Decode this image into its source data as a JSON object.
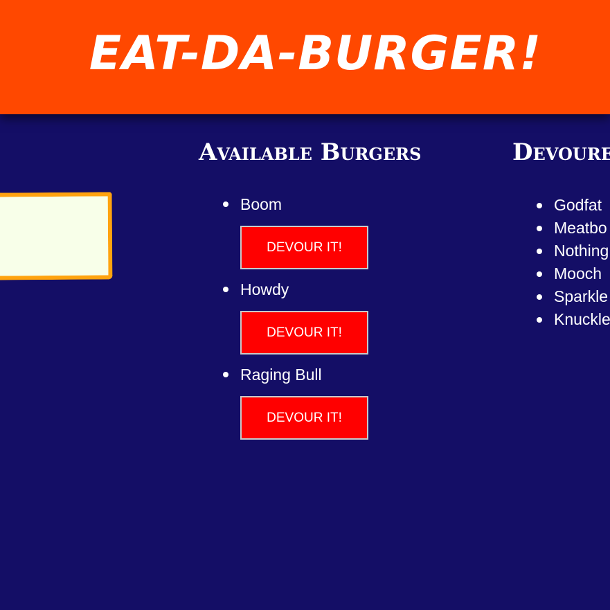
{
  "header": {
    "title": "EAT-DA-BURGER!"
  },
  "add_form": {
    "input_value": ""
  },
  "available": {
    "heading": "Available Burgers",
    "items": [
      {
        "name": "Boom",
        "button_label": "DEVOUR IT!"
      },
      {
        "name": "Howdy",
        "button_label": "DEVOUR IT!"
      },
      {
        "name": "Raging Bull",
        "button_label": "DEVOUR IT!"
      }
    ]
  },
  "devoured": {
    "heading": "Devoure",
    "items": [
      {
        "name": "Godfat"
      },
      {
        "name": "Meatbo"
      },
      {
        "name": "Nothing"
      },
      {
        "name": "Mooch"
      },
      {
        "name": "Sparkle"
      },
      {
        "name": "Knuckle"
      }
    ]
  },
  "colors": {
    "background": "#140e66",
    "header": "#ff4800",
    "button": "#ff0000",
    "input_border": "#ffa30f"
  }
}
